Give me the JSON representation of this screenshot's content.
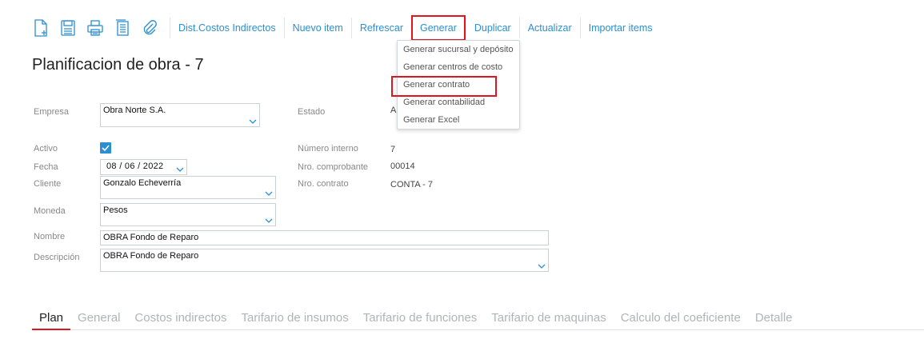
{
  "toolbar": {
    "icons": [
      "new-document-icon",
      "save-icon",
      "print-icon",
      "report-icon",
      "attach-icon"
    ],
    "buttons": {
      "dist_costos": "Dist.Costos Indirectos",
      "nuevo_item": "Nuevo item",
      "refrescar": "Refrescar",
      "generar": "Generar",
      "duplicar": "Duplicar",
      "actualizar": "Actualizar",
      "importar": "Importar items"
    }
  },
  "generar_menu": {
    "items": [
      "Generar sucursal y depósito",
      "Generar centros de costo",
      "Generar contrato",
      "Generar contabilidad",
      "Generar Excel"
    ]
  },
  "page_title": "Planificacion de obra - 7",
  "form": {
    "empresa": {
      "label": "Empresa",
      "value": "Obra Norte S.A."
    },
    "estado": {
      "label": "Estado",
      "value": "A"
    },
    "activo": {
      "label": "Activo",
      "checked": true
    },
    "numero_interno": {
      "label": "Número interno",
      "value": "7"
    },
    "fecha": {
      "label": "Fecha",
      "value": "08 / 06 / 2022"
    },
    "nro_comprobante": {
      "label": "Nro. comprobante",
      "value": "00014"
    },
    "cliente": {
      "label": "Cliente",
      "value": "Gonzalo Echeverría"
    },
    "nro_contrato": {
      "label": "Nro. contrato",
      "value": "CONTA - 7"
    },
    "moneda": {
      "label": "Moneda",
      "value": "Pesos"
    },
    "nombre": {
      "label": "Nombre",
      "value": "OBRA Fondo de Reparo"
    },
    "descripcion": {
      "label": "Descripción",
      "value": "OBRA Fondo de Reparo"
    }
  },
  "tabs": [
    "Plan",
    "General",
    "Costos indirectos",
    "Tarifario de insumos",
    "Tarifario de funciones",
    "Tarifario de maquinas",
    "Calculo del coeficiente",
    "Detalle"
  ],
  "colors": {
    "accent": "#2a8fd0",
    "highlight": "#e0161c"
  }
}
